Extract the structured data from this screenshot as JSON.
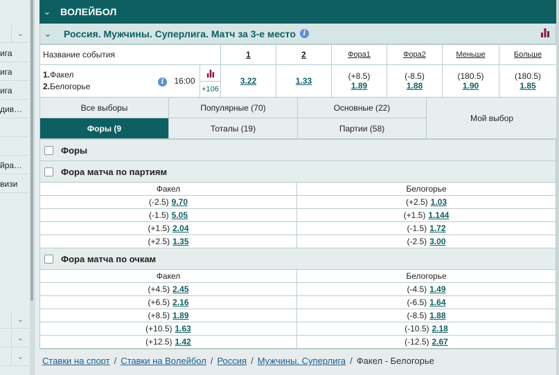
{
  "sidebar": {
    "items": [
      {
        "label": "",
        "chevron": true
      },
      {
        "label": "ига",
        "chevron": false
      },
      {
        "label": "ига",
        "chevron": false
      },
      {
        "label": "ига",
        "chevron": false
      },
      {
        "label": "див…",
        "chevron": false
      },
      {
        "label": "",
        "chevron": false
      },
      {
        "label": "",
        "chevron": false
      },
      {
        "label": "йра…",
        "chevron": false
      },
      {
        "label": "визи",
        "chevron": false
      }
    ],
    "bottom_chevrons": 3,
    "chevron_icon": "chevron-down-icon"
  },
  "sport": {
    "title": "ВОЛЕЙБОЛ",
    "chevron_icon": "chevron-down-icon"
  },
  "league": {
    "title": "Россия. Мужчины. Суперлига. Матч за 3-е место",
    "info_glyph": "i",
    "stats_icon": "bar-chart-icon",
    "stats_color": "#8b1a4a"
  },
  "event_table": {
    "headers": {
      "name": "Название события",
      "h1": "1",
      "h2": "2",
      "fora1": "Фора1",
      "fora2": "Фора2",
      "less": "Меньше",
      "more": "Больше"
    },
    "event": {
      "team1_num": "1.",
      "team1": "Факел",
      "team2_num": "2.",
      "team2": "Белогорье",
      "info_glyph": "i",
      "time": "16:00",
      "more_markets": "+106",
      "odd1": "3.22",
      "odd2": "1.33",
      "fora1_param": "(+8.5)",
      "fora1_odd": "1.89",
      "fora2_param": "(-8.5)",
      "fora2_odd": "1.88",
      "less_param": "(180.5)",
      "less_odd": "1.90",
      "more_param": "(180.5)",
      "more_odd": "1.85"
    }
  },
  "filters": {
    "all": "Все выборы",
    "popular": "Популярные (70)",
    "main": "Основные (22)",
    "mine": "Мой выбор",
    "foras": "Форы (9",
    "totals": "Тоталы (19)",
    "sets": "Партии (58)"
  },
  "markets": {
    "foras_title": "Форы",
    "sets_title": "Фора матча по партиям",
    "points_title": "Фора матча по очкам",
    "col1": "Факел",
    "col2": "Белогорье",
    "sets_rows": [
      {
        "p1": "(-2.5)",
        "o1": "9.70",
        "p2": "(+2.5)",
        "o2": "1.03"
      },
      {
        "p1": "(-1.5)",
        "o1": "5.05",
        "p2": "(+1.5)",
        "o2": "1.144"
      },
      {
        "p1": "(+1.5)",
        "o1": "2.04",
        "p2": "(-1.5)",
        "o2": "1.72"
      },
      {
        "p1": "(+2.5)",
        "o1": "1.35",
        "p2": "(-2.5)",
        "o2": "3.00"
      }
    ],
    "points_rows": [
      {
        "p1": "(+4.5)",
        "o1": "2.45",
        "p2": "(-4.5)",
        "o2": "1.49"
      },
      {
        "p1": "(+6.5)",
        "o1": "2.16",
        "p2": "(-6.5)",
        "o2": "1.64"
      },
      {
        "p1": "(+8.5)",
        "o1": "1.89",
        "p2": "(-8.5)",
        "o2": "1.88"
      },
      {
        "p1": "(+10.5)",
        "o1": "1.63",
        "p2": "(-10.5)",
        "o2": "2.18"
      },
      {
        "p1": "(+12.5)",
        "o1": "1.42",
        "p2": "(-12.5)",
        "o2": "2.67"
      }
    ]
  },
  "breadcrumb": {
    "items": [
      "Ставки на спорт",
      "Ставки на Волейбол",
      "Россия",
      "Мужчины. Суперлига"
    ],
    "current": "Факел - Белогорье",
    "separator": "/"
  }
}
